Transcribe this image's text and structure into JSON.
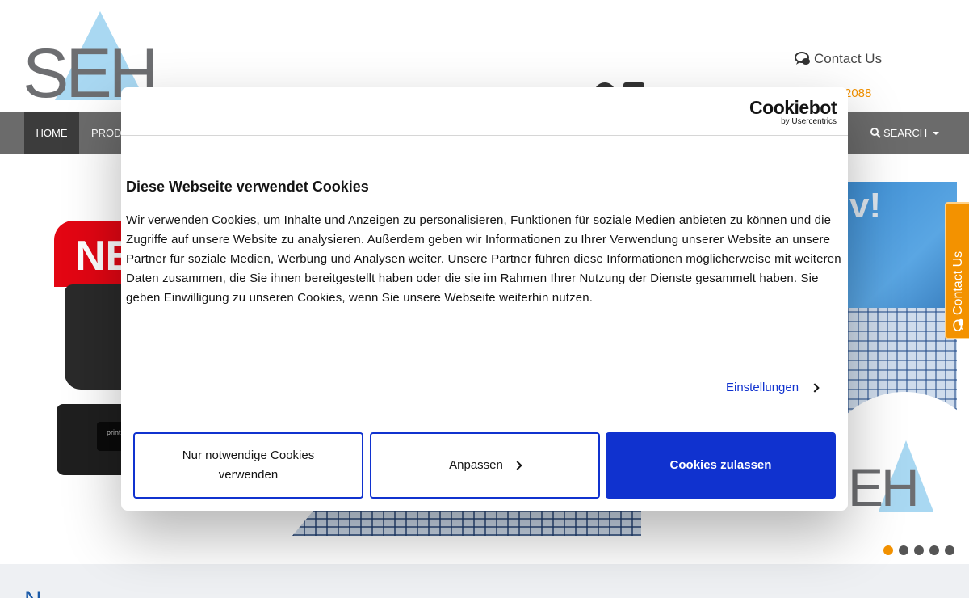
{
  "header": {
    "logo_text": "SEH",
    "contact_label": "Contact Us",
    "phone_partial": "2088"
  },
  "nav": {
    "home_label": "HOME",
    "products_label": "PRODU",
    "search_label": "SEARCH"
  },
  "slider": {
    "badge_text": "NE",
    "device_label": "print",
    "banner_text": "v!",
    "logo_text": "EH",
    "dots_count": 5,
    "active_dot": 0
  },
  "side_tab": {
    "label": "Contact Us"
  },
  "lower": {
    "heading_partial": "N"
  },
  "cookie_dialog": {
    "brand_main": "Cookiebot",
    "brand_sub": "by Usercentrics",
    "title": "Diese Webseite verwendet Cookies",
    "body": "Wir verwenden Cookies, um Inhalte und Anzeigen zu personalisieren, Funktionen für soziale Medien anbieten zu können und die Zugriffe auf unsere Website zu analysieren. Außerdem geben wir Informationen zu Ihrer Verwendung unserer Website an unsere Partner für soziale Medien, Werbung und Analysen weiter. Unsere Partner führen diese Informationen möglicherweise mit weiteren Daten zusammen, die Sie ihnen bereitgestellt haben oder die sie im Rahmen Ihrer Nutzung der Dienste gesammelt haben. Sie geben Einwilligung zu unseren Cookies, wenn Sie unsere Webseite weiterhin nutzen.",
    "settings_label": "Einstellungen",
    "btn_necessary": "Nur notwendige Cookies verwenden",
    "btn_customize": "Anpassen",
    "btn_allow": "Cookies zulassen",
    "accent_color": "#1032cf"
  },
  "colors": {
    "brand_orange": "#f39200",
    "nav_gray": "#6b6b6b",
    "nav_active": "#3c3c3c"
  }
}
